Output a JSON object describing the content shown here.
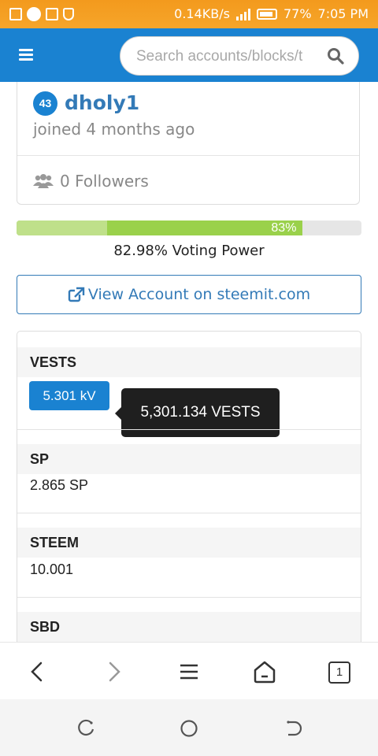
{
  "status_bar": {
    "network_speed": "0.14KB/s",
    "battery": "77%",
    "time": "7:05 PM"
  },
  "header": {
    "search_placeholder": "Search accounts/blocks/t"
  },
  "profile": {
    "reputation": "43",
    "username": "dholy1",
    "joined": "joined 4 months ago",
    "followers": "0 Followers"
  },
  "voting_power": {
    "value": 0.8298,
    "badge": "83%",
    "label": "82.98% Voting Power",
    "colors": {
      "fill": "#9ad14b",
      "track": "#e6e6e6"
    }
  },
  "view_account": {
    "label": "View Account on steemit.com"
  },
  "balances": {
    "vests": {
      "title": "VESTS",
      "button": "5.301 kV",
      "tooltip": "5,301.134 VESTS"
    },
    "sp": {
      "title": "SP",
      "value": "2.865 SP"
    },
    "steem": {
      "title": "STEEM",
      "value": "10.001"
    },
    "sbd": {
      "title": "SBD"
    }
  },
  "browser_toolbar": {
    "tab_count": "1",
    "icons": [
      "back-icon",
      "forward-icon",
      "menu-icon",
      "home-icon",
      "tabs-icon"
    ]
  },
  "system_nav": {
    "icons": [
      "recents-icon",
      "home-circle-icon",
      "back-nav-icon"
    ]
  },
  "colors": {
    "status_bar": "#f5a623",
    "app_bar": "#1a82d1",
    "link": "#337ab7"
  }
}
